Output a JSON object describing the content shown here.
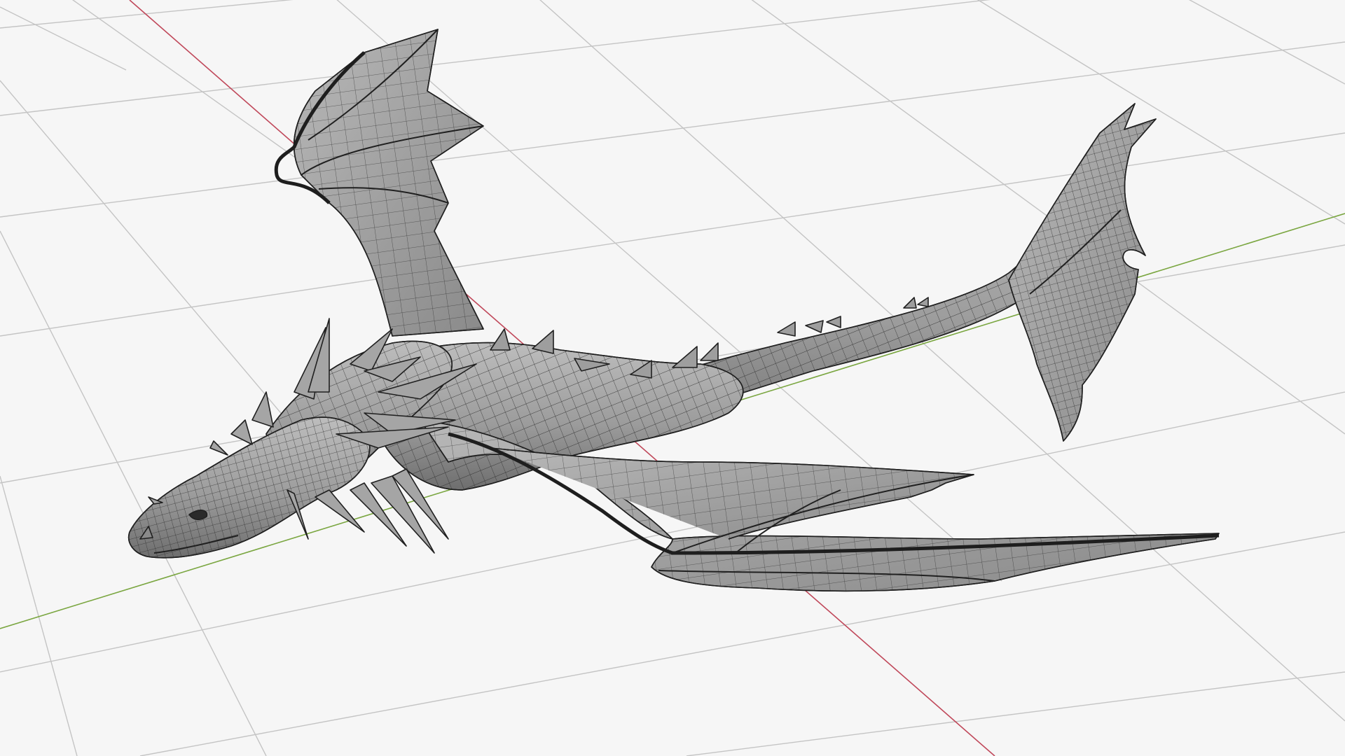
{
  "viewport": {
    "shading": "solid",
    "overlay": "wireframe",
    "background_color": "#f6f6f6",
    "grid_color": "#c4c4c4",
    "x_axis_color": "#c0485a",
    "y_axis_color": "#7aa640"
  },
  "object": {
    "type": "mesh",
    "subject": "dragon",
    "base_color": "#9a9a9a",
    "wire_color": "#2a2a2a",
    "parts": [
      "head",
      "horns",
      "neck",
      "body",
      "tail",
      "tail-fin",
      "left-wing",
      "right-wing",
      "dorsal-spikes"
    ]
  }
}
